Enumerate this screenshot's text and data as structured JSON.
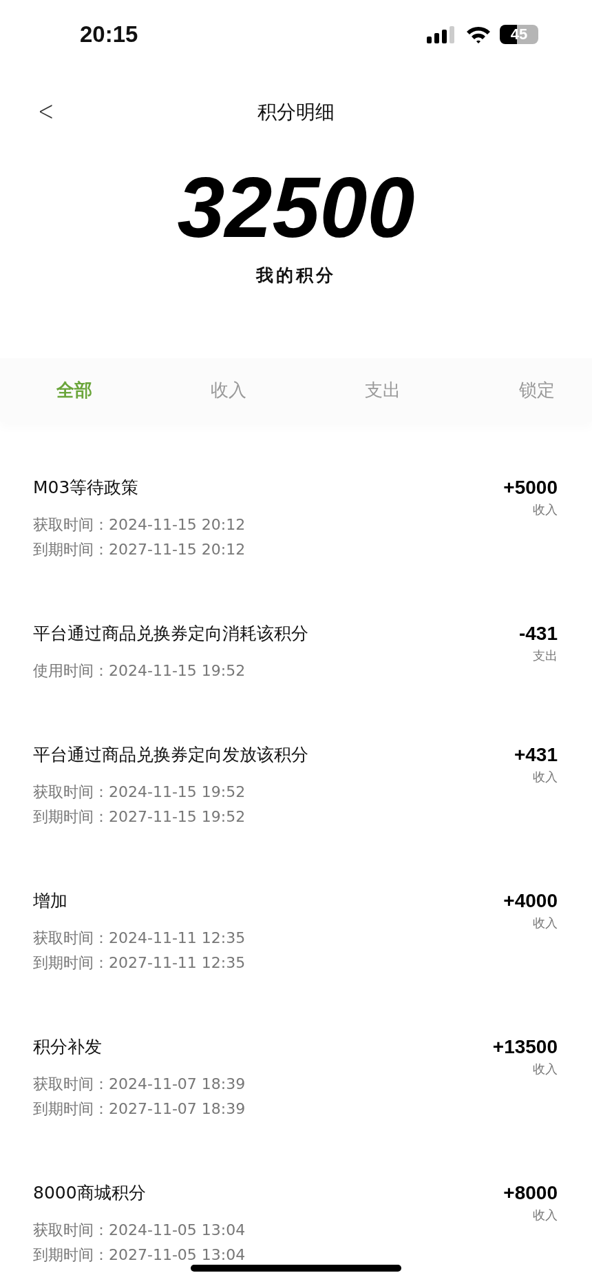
{
  "status_bar": {
    "time": "20:15",
    "battery": "45"
  },
  "nav": {
    "back": "<",
    "title": "积分明细"
  },
  "points": {
    "value": "32500",
    "label": "我的积分"
  },
  "tabs": [
    {
      "label": "全部",
      "selected": true
    },
    {
      "label": "收入",
      "selected": false
    },
    {
      "label": "支出",
      "selected": false
    },
    {
      "label": "锁定",
      "selected": false
    }
  ],
  "records": [
    {
      "title": "M03等待政策",
      "amount": "+5000",
      "type": "收入",
      "dates": [
        "获取时间：2024-11-15 20:12",
        "到期时间：2027-11-15 20:12"
      ]
    },
    {
      "title": "平台通过商品兑换券定向消耗该积分",
      "amount": "-431",
      "type": "支出",
      "dates": [
        "使用时间：2024-11-15 19:52"
      ]
    },
    {
      "title": "平台通过商品兑换券定向发放该积分",
      "amount": "+431",
      "type": "收入",
      "dates": [
        "获取时间：2024-11-15 19:52",
        "到期时间：2027-11-15 19:52"
      ]
    },
    {
      "title": "增加",
      "amount": "+4000",
      "type": "收入",
      "dates": [
        "获取时间：2024-11-11 12:35",
        "到期时间：2027-11-11 12:35"
      ]
    },
    {
      "title": "积分补发",
      "amount": "+13500",
      "type": "收入",
      "dates": [
        "获取时间：2024-11-07 18:39",
        "到期时间：2027-11-07 18:39"
      ]
    },
    {
      "title": "8000商城积分",
      "amount": "+8000",
      "type": "收入",
      "dates": [
        "获取时间：2024-11-05 13:04",
        "到期时间：2027-11-05 13:04"
      ]
    }
  ]
}
